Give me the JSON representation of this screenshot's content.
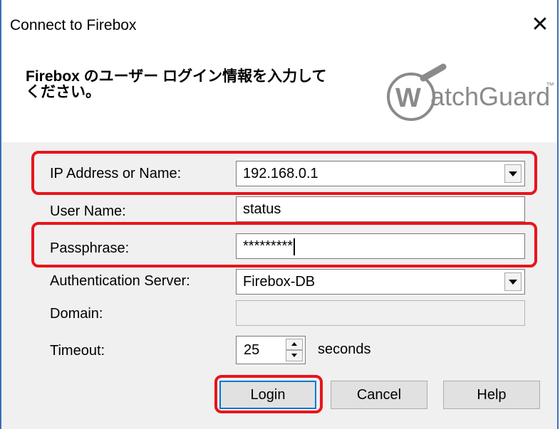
{
  "window": {
    "title": "Connect to Firebox"
  },
  "header": {
    "message_line1": "Firebox のユーザー ログイン情報を入力して",
    "message_line2": "ください。"
  },
  "logo": {
    "text": "atchGuard",
    "tm": "™"
  },
  "form": {
    "ip_label": "IP Address or Name:",
    "ip_value": "192.168.0.1",
    "user_label": "User Name:",
    "user_value": "status",
    "pass_label": "Passphrase:",
    "pass_value": "*********",
    "auth_label": "Authentication Server:",
    "auth_value": "Firebox-DB",
    "domain_label": "Domain:",
    "domain_value": "",
    "timeout_label": "Timeout:",
    "timeout_value": "25",
    "timeout_unit": "seconds"
  },
  "buttons": {
    "login": "Login",
    "cancel": "Cancel",
    "help": "Help"
  },
  "colors": {
    "highlight": "#e8141c",
    "window_border": "#3c6fb6",
    "logo_gray": "#8a8a8a"
  },
  "icons": [
    "close-icon",
    "chevron-down-icon",
    "spin-up-icon",
    "spin-down-icon",
    "watchguard-logo"
  ]
}
